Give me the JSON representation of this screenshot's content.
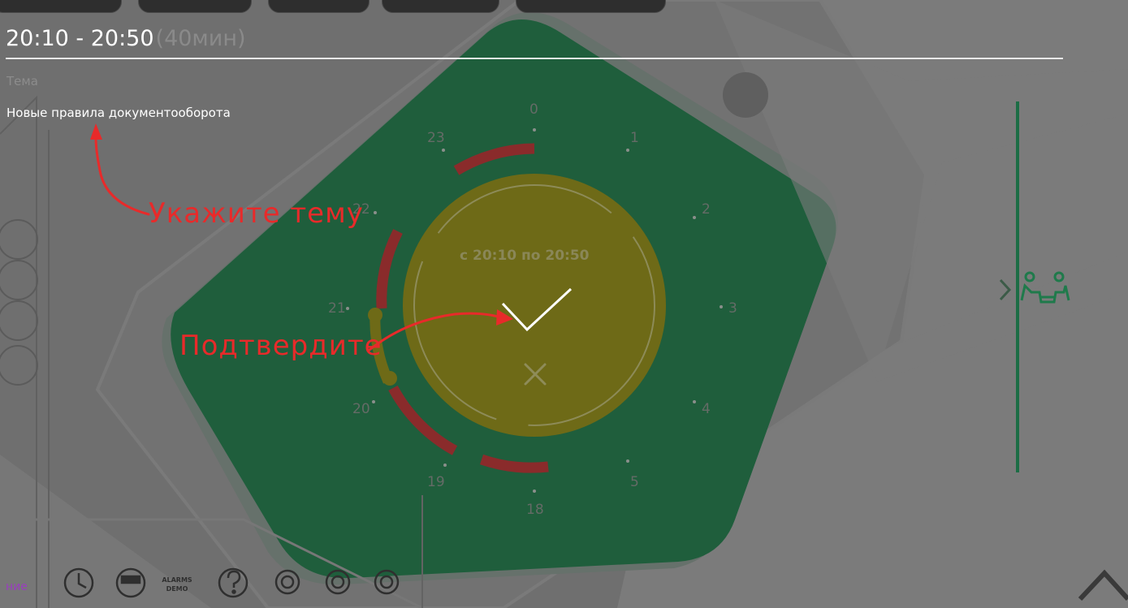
{
  "header": {
    "time_range": "20:10 - 20:50",
    "duration": "(40мин)"
  },
  "topic": {
    "label": "Тема",
    "value": "Новые правила документооборота"
  },
  "annotations": {
    "topic_hint": "Укажите тему",
    "confirm_hint": "Подтвердите"
  },
  "clock": {
    "range_text": "с 20:10 по 20:50",
    "hours": [
      "0",
      "1",
      "2",
      "3",
      "4",
      "5",
      "18",
      "19",
      "20",
      "21",
      "22",
      "23"
    ]
  },
  "bottom_bar": {
    "partial_label": "ние",
    "alarms_line1": "ALARMS",
    "alarms_line2": "DEMO"
  },
  "colors": {
    "overlay": "#6f6f6f",
    "room_green": "#1f5e3c",
    "selected_yellow": "#6e6a17",
    "booked_red": "#8a2b2b",
    "annotation_red": "#e82a2a",
    "side_green": "#1c6d45"
  },
  "icons": [
    "clock-icon",
    "meter-icon",
    "help-icon",
    "settings-1-icon",
    "settings-2-icon",
    "settings-3-icon",
    "meeting-people-icon",
    "chevron-up-icon",
    "confirm-check-icon",
    "cancel-x-icon"
  ]
}
